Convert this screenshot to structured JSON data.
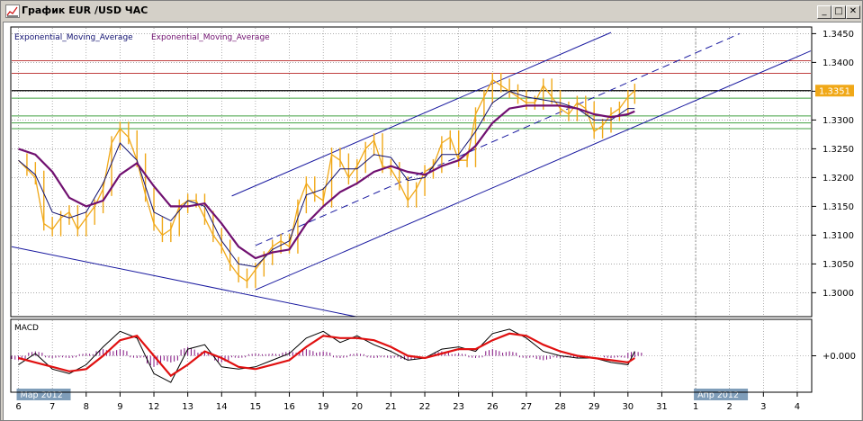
{
  "window": {
    "title": "График EUR /USD  ЧАС",
    "minimize_glyph": "_",
    "maximize_glyph": "□",
    "close_glyph": "✕",
    "icon": "chart-window-icon"
  },
  "colors": {
    "price": "#f0a818",
    "ema_fast": "#101070",
    "ema_slow": "#701070",
    "channel": "#1a1aa0",
    "resistance": "#c04040",
    "support": "#40a040",
    "current_line": "#000000",
    "macd_line": "#000000",
    "macd_signal": "#e01010",
    "macd_hist": "#801080",
    "grid": "#7a7a7a",
    "price_tag_bg": "#f0a818"
  },
  "chart_data": [
    {
      "type": "line",
      "title": "",
      "legend": [
        "Exponential_Moving_Average",
        "Exponential_Moving_Average"
      ],
      "legend_placement": "top-left",
      "ylim": [
        1.296,
        1.346
      ],
      "y_ticks": [
        "1.3450",
        "1.3400",
        "1.3350",
        "1.3300",
        "1.3250",
        "1.3200",
        "1.3150",
        "1.3100",
        "1.3050",
        "1.3000"
      ],
      "y_tick_values": [
        1.345,
        1.34,
        1.335,
        1.33,
        1.325,
        1.32,
        1.315,
        1.31,
        1.305,
        1.3
      ],
      "x_ticks": [
        "6",
        "7",
        "8",
        "9",
        "12",
        "13",
        "14",
        "15",
        "16",
        "19",
        "20",
        "21",
        "22",
        "23",
        "26",
        "27",
        "28",
        "29",
        "30",
        "31",
        "1",
        "2",
        "3",
        "4"
      ],
      "x_tick_index": [
        0,
        1,
        2,
        3,
        4,
        5,
        6,
        7,
        8,
        9,
        10,
        11,
        12,
        13,
        14,
        15,
        16,
        17,
        18,
        19,
        20,
        21,
        22,
        23
      ],
      "x_range_index": [
        -0.2,
        23.4
      ],
      "month_labels": [
        {
          "label": "Мар 2012",
          "at": 0
        },
        {
          "label": "Апр 2012",
          "at": 20
        }
      ],
      "grid": true,
      "current_price_label": "1.3351",
      "current_price": 1.3351,
      "horizontal_levels": [
        {
          "kind": "resistance",
          "value": 1.3403
        },
        {
          "kind": "resistance",
          "value": 1.3381
        },
        {
          "kind": "current",
          "value": 1.3351
        },
        {
          "kind": "support",
          "value": 1.3338
        },
        {
          "kind": "support",
          "value": 1.3307
        },
        {
          "kind": "support",
          "value": 1.3295
        },
        {
          "kind": "support",
          "value": 1.3285
        }
      ],
      "trend_lines": [
        {
          "kind": "channel-lower",
          "x": [
            7.0,
            23.4
          ],
          "y": [
            1.3005,
            1.342
          ],
          "style": "solid"
        },
        {
          "kind": "channel-upper",
          "x": [
            6.3,
            17.5
          ],
          "y": [
            1.3168,
            1.3452
          ],
          "style": "solid"
        },
        {
          "kind": "channel-mid",
          "x": [
            7.0,
            21.3
          ],
          "y": [
            1.3082,
            1.345
          ],
          "style": "dashed"
        },
        {
          "kind": "down-line",
          "x": [
            -0.2,
            10.0
          ],
          "y": [
            1.308,
            1.2958
          ],
          "style": "solid"
        }
      ],
      "series": [
        {
          "kind": "price",
          "x": [
            0.0,
            0.25,
            0.5,
            0.75,
            1.0,
            1.25,
            1.5,
            1.75,
            2.0,
            2.25,
            2.5,
            2.75,
            3.0,
            3.25,
            3.5,
            3.75,
            4.0,
            4.25,
            4.5,
            4.75,
            5.0,
            5.25,
            5.5,
            5.75,
            6.0,
            6.25,
            6.5,
            6.75,
            7.0,
            7.25,
            7.5,
            7.75,
            8.0,
            8.25,
            8.5,
            8.75,
            9.0,
            9.25,
            9.5,
            9.75,
            10.0,
            10.25,
            10.5,
            10.75,
            11.0,
            11.25,
            11.5,
            11.75,
            12.0,
            12.25,
            12.5,
            12.75,
            13.0,
            13.25,
            13.5,
            13.75,
            14.0,
            14.25,
            14.5,
            14.75,
            15.0,
            15.25,
            15.5,
            15.75,
            16.0,
            16.25,
            16.5,
            16.75,
            17.0,
            17.25,
            17.5,
            17.75,
            18.0,
            18.2
          ],
          "values": [
            1.323,
            1.3215,
            1.32,
            1.312,
            1.311,
            1.313,
            1.314,
            1.311,
            1.313,
            1.315,
            1.318,
            1.326,
            1.3285,
            1.327,
            1.323,
            1.317,
            1.312,
            1.31,
            1.311,
            1.315,
            1.316,
            1.316,
            1.313,
            1.31,
            1.308,
            1.305,
            1.303,
            1.302,
            1.304,
            1.306,
            1.308,
            1.309,
            1.308,
            1.315,
            1.319,
            1.317,
            1.316,
            1.324,
            1.323,
            1.32,
            1.322,
            1.325,
            1.3265,
            1.322,
            1.3215,
            1.319,
            1.316,
            1.318,
            1.321,
            1.322,
            1.326,
            1.327,
            1.323,
            1.323,
            1.331,
            1.334,
            1.337,
            1.336,
            1.335,
            1.334,
            1.333,
            1.333,
            1.336,
            1.334,
            1.332,
            1.331,
            1.333,
            1.332,
            1.328,
            1.329,
            1.331,
            1.332,
            1.334,
            1.3351
          ]
        },
        {
          "kind": "ema_fast",
          "name": "Exponential_Moving_Average",
          "x": [
            0.0,
            0.5,
            1.0,
            1.5,
            2.0,
            2.5,
            3.0,
            3.5,
            4.0,
            4.5,
            5.0,
            5.5,
            6.0,
            6.5,
            7.0,
            7.5,
            8.0,
            8.5,
            9.0,
            9.5,
            10.0,
            10.5,
            11.0,
            11.5,
            12.0,
            12.5,
            13.0,
            13.5,
            14.0,
            14.5,
            15.0,
            15.5,
            16.0,
            16.5,
            17.0,
            17.5,
            18.0,
            18.2
          ],
          "values": [
            1.323,
            1.3205,
            1.314,
            1.313,
            1.314,
            1.319,
            1.326,
            1.323,
            1.314,
            1.3125,
            1.316,
            1.315,
            1.309,
            1.305,
            1.3045,
            1.3075,
            1.309,
            1.317,
            1.318,
            1.3215,
            1.3215,
            1.324,
            1.3235,
            1.3195,
            1.32,
            1.324,
            1.324,
            1.328,
            1.333,
            1.335,
            1.334,
            1.3335,
            1.333,
            1.332,
            1.33,
            1.33,
            1.332,
            1.332
          ]
        },
        {
          "kind": "ema_slow",
          "name": "Exponential_Moving_Average",
          "x": [
            0.0,
            0.5,
            1.0,
            1.5,
            2.0,
            2.5,
            3.0,
            3.5,
            4.0,
            4.5,
            5.0,
            5.5,
            6.0,
            6.5,
            7.0,
            7.5,
            8.0,
            8.5,
            9.0,
            9.5,
            10.0,
            10.5,
            11.0,
            11.5,
            12.0,
            12.5,
            13.0,
            13.5,
            14.0,
            14.5,
            15.0,
            15.5,
            16.0,
            16.5,
            17.0,
            17.5,
            18.0,
            18.2
          ],
          "values": [
            1.325,
            1.324,
            1.321,
            1.3165,
            1.315,
            1.316,
            1.3205,
            1.3225,
            1.3185,
            1.315,
            1.315,
            1.3155,
            1.312,
            1.308,
            1.306,
            1.307,
            1.3075,
            1.312,
            1.315,
            1.3175,
            1.319,
            1.321,
            1.322,
            1.321,
            1.3205,
            1.322,
            1.323,
            1.3255,
            1.3295,
            1.332,
            1.3325,
            1.3325,
            1.3325,
            1.332,
            1.331,
            1.3305,
            1.331,
            1.3315
          ]
        }
      ]
    },
    {
      "type": "line",
      "title": "MACD",
      "legend_placement": "top-left",
      "ylim": [
        -1.6,
        1.6
      ],
      "y_ticks": [
        "+0.000"
      ],
      "y_tick_values": [
        0
      ],
      "grid": true,
      "series": [
        {
          "kind": "macd_line",
          "x": [
            0.0,
            0.5,
            1.0,
            1.5,
            2.0,
            2.5,
            3.0,
            3.5,
            4.0,
            4.5,
            5.0,
            5.5,
            6.0,
            6.5,
            7.0,
            7.5,
            8.0,
            8.5,
            9.0,
            9.5,
            10.0,
            10.5,
            11.0,
            11.5,
            12.0,
            12.5,
            13.0,
            13.5,
            14.0,
            14.5,
            15.0,
            15.5,
            16.0,
            16.5,
            17.0,
            17.5,
            18.0,
            18.2
          ],
          "values": [
            -0.4,
            0.1,
            -0.6,
            -0.8,
            -0.4,
            0.4,
            1.1,
            0.8,
            -0.8,
            -1.2,
            0.3,
            0.5,
            -0.5,
            -0.6,
            -0.5,
            -0.2,
            0.1,
            0.8,
            1.1,
            0.6,
            0.9,
            0.5,
            0.2,
            -0.2,
            -0.1,
            0.3,
            0.4,
            0.2,
            1.0,
            1.2,
            0.8,
            0.2,
            0.0,
            -0.1,
            -0.1,
            -0.3,
            -0.4,
            0.2
          ]
        },
        {
          "kind": "macd_signal",
          "x": [
            0.0,
            0.5,
            1.0,
            1.5,
            2.0,
            2.5,
            3.0,
            3.5,
            4.0,
            4.5,
            5.0,
            5.5,
            6.0,
            6.5,
            7.0,
            7.5,
            8.0,
            8.5,
            9.0,
            9.5,
            10.0,
            10.5,
            11.0,
            11.5,
            12.0,
            12.5,
            13.0,
            13.5,
            14.0,
            14.5,
            15.0,
            15.5,
            16.0,
            16.5,
            17.0,
            17.5,
            18.0,
            18.2
          ],
          "values": [
            -0.1,
            -0.3,
            -0.5,
            -0.7,
            -0.6,
            0.0,
            0.7,
            0.9,
            0.0,
            -0.9,
            -0.4,
            0.2,
            -0.1,
            -0.5,
            -0.6,
            -0.4,
            -0.2,
            0.4,
            0.9,
            0.8,
            0.8,
            0.7,
            0.4,
            0.0,
            -0.1,
            0.1,
            0.3,
            0.3,
            0.7,
            1.0,
            0.9,
            0.5,
            0.2,
            0.0,
            -0.1,
            -0.2,
            -0.3,
            -0.1
          ]
        },
        {
          "kind": "macd_hist",
          "x": [
            0.0,
            0.5,
            1.0,
            1.5,
            2.0,
            2.5,
            3.0,
            3.5,
            4.0,
            4.5,
            5.0,
            5.5,
            6.0,
            6.5,
            7.0,
            7.5,
            8.0,
            8.5,
            9.0,
            9.5,
            10.0,
            10.5,
            11.0,
            11.5,
            12.0,
            12.5,
            13.0,
            13.5,
            14.0,
            14.5,
            15.0,
            15.5,
            16.0,
            16.5,
            17.0,
            17.5,
            18.0,
            18.2
          ],
          "values": [
            -0.2,
            0.2,
            -0.1,
            -0.1,
            0.1,
            0.3,
            0.3,
            -0.1,
            -0.5,
            -0.3,
            0.4,
            0.2,
            -0.3,
            -0.1,
            0.1,
            0.1,
            0.2,
            0.3,
            0.2,
            -0.1,
            0.1,
            -0.1,
            -0.1,
            -0.2,
            0.0,
            0.2,
            0.1,
            -0.1,
            0.3,
            0.2,
            -0.1,
            -0.2,
            -0.1,
            -0.1,
            0.0,
            -0.1,
            -0.1,
            0.2
          ]
        }
      ]
    }
  ]
}
